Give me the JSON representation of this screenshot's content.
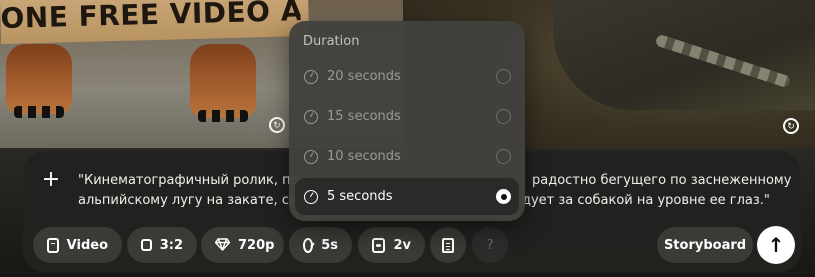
{
  "background": {
    "left_sign_text": "ONE FREE VIDEO A DAY",
    "badge_icon": "loop-icon"
  },
  "composer": {
    "add_icon": "+",
    "prompt_visible_left": [
      "\"Кинематографичный ролик, пок",
      "альпийскому лугу на закате, снеж"
    ],
    "prompt_visible_right": [
      "радостно бегущего по заснеженному",
      "дует за собакой на уровне ее глаз.\""
    ],
    "chips": {
      "type": "Video",
      "aspect_ratio": "3:2",
      "quality": "720p",
      "duration": "5s",
      "variations": "2v",
      "help": "?"
    },
    "storyboard_label": "Storyboard",
    "submit_icon": "↑"
  },
  "duration_menu": {
    "title": "Duration",
    "options": [
      {
        "label": "20 seconds",
        "selected": false
      },
      {
        "label": "15 seconds",
        "selected": false
      },
      {
        "label": "10 seconds",
        "selected": false
      },
      {
        "label": "5 seconds",
        "selected": true
      }
    ]
  },
  "colors": {
    "composer_bg": "#22211f",
    "chip_bg": "#3b3a37",
    "menu_bg": "#42413e",
    "selected_row_bg": "#2b2a28"
  }
}
